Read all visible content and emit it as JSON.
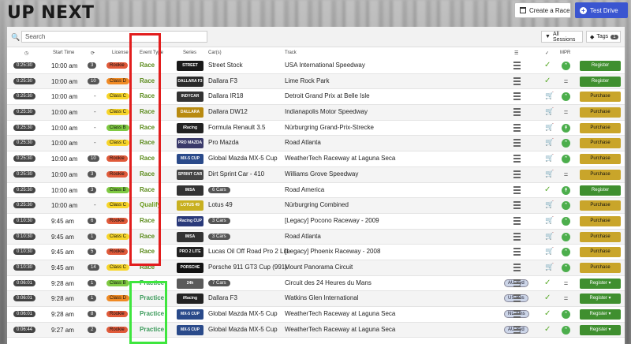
{
  "page": {
    "title": "UP NEXT"
  },
  "buttons": {
    "create_race": "Create a Race",
    "test_drive": "Test Drive",
    "all_sessions": "All Sessions",
    "tags": "Tags",
    "tags_count": "1"
  },
  "search": {
    "placeholder": "Search"
  },
  "headers": {
    "start_time": "Start Time",
    "license": "License",
    "event_type": "Event Type",
    "series": "Series",
    "cars": "Car(s)",
    "track": "Track",
    "mpr": "MPR"
  },
  "colors": {
    "class_d": "#f08a24",
    "class_c": "#f7d52a",
    "class_b": "#7fc942",
    "rookie": "#e05a3a",
    "register": "#3f8f2f",
    "purchase": "#c9a52a",
    "race_box": "#e21d1d",
    "practice_box": "#3ee63e"
  },
  "rows": [
    {
      "timer": "0:25:30",
      "start": "10:00 am",
      "drivers": "3",
      "license": "Rookie",
      "lic_color": "#e05a3a",
      "event": "Race",
      "series_logo": "STREET STOCK",
      "logo_color": "#1a1a1a",
      "cars": "Street Stock",
      "track": "USA International Speedway",
      "owned": true,
      "mpr": "up",
      "action": "Register"
    },
    {
      "timer": "0:25:30",
      "start": "10:00 am",
      "drivers": "10",
      "license": "Class D",
      "lic_color": "#f08a24",
      "event": "Race",
      "series_logo": "DALLARA F3",
      "logo_color": "#2a2a2a",
      "cars": "Dallara F3",
      "track": "Lime Rock Park",
      "owned": true,
      "mpr": "eq",
      "action": "Register"
    },
    {
      "timer": "0:25:30",
      "start": "10:00 am",
      "drivers": "",
      "license": "Class C",
      "lic_color": "#f7d52a",
      "event": "Race",
      "series_logo": "INDYCAR",
      "logo_color": "#333",
      "cars": "Dallara IR18",
      "track": "Detroit Grand Prix at Belle Isle",
      "owned": false,
      "mpr": "up",
      "action": "Purchase"
    },
    {
      "timer": "0:25:30",
      "start": "10:00 am",
      "drivers": "",
      "license": "Class C",
      "lic_color": "#f7d52a",
      "event": "Race",
      "series_logo": "DALLARA DASH",
      "logo_color": "#b88a10",
      "cars": "Dallara DW12",
      "track": "Indianapolis Motor Speedway",
      "owned": false,
      "mpr": "eq",
      "action": "Purchase"
    },
    {
      "timer": "0:25:30",
      "start": "10:00 am",
      "drivers": "",
      "license": "Class B",
      "lic_color": "#7fc942",
      "event": "Race",
      "series_logo": "iRacing FORMULA 3.5",
      "logo_color": "#222",
      "cars": "Formula Renault 3.5",
      "track": "Nürburgring Grand-Prix-Strecke",
      "owned": false,
      "mpr": "up2",
      "action": "Purchase"
    },
    {
      "timer": "0:25:30",
      "start": "10:00 am",
      "drivers": "",
      "license": "Class C",
      "lic_color": "#f7d52a",
      "event": "Race",
      "series_logo": "PRO MAZDA",
      "logo_color": "#3a3a6a",
      "cars": "Pro Mazda",
      "track": "Road Atlanta",
      "owned": false,
      "mpr": "up",
      "action": "Purchase"
    },
    {
      "timer": "0:25:30",
      "start": "10:00 am",
      "drivers": "10",
      "license": "Rookie",
      "lic_color": "#e05a3a",
      "event": "Race",
      "series_logo": "MX-5 CUP",
      "logo_color": "#2a4a8a",
      "cars": "Global Mazda MX-5 Cup",
      "track": "WeatherTech Raceway at Laguna Seca",
      "owned": false,
      "mpr": "up",
      "action": "Purchase"
    },
    {
      "timer": "0:25:30",
      "start": "10:00 am",
      "drivers": "3",
      "license": "Rookie",
      "lic_color": "#e05a3a",
      "event": "Race",
      "series_logo": "SPRINT CAR",
      "logo_color": "#444",
      "cars": "Dirt Sprint Car - 410",
      "track": "Williams Grove Speedway",
      "owned": false,
      "mpr": "eq",
      "action": "Purchase"
    },
    {
      "timer": "0:25:30",
      "start": "10:00 am",
      "drivers": "3",
      "license": "Class B",
      "lic_color": "#7fc942",
      "event": "Race",
      "series_logo": "IMSA",
      "logo_color": "#333",
      "cars": "6 Cars",
      "cars_badge": true,
      "track": "Road America",
      "owned": true,
      "mpr": "up2",
      "action": "Register"
    },
    {
      "timer": "0:25:30",
      "start": "10:00 am",
      "drivers": "",
      "license": "Class C",
      "lic_color": "#f7d52a",
      "event": "Qualify",
      "series_logo": "LOTUS 49",
      "logo_color": "#c8b020",
      "cars": "Lotus 49",
      "track": "Nürburgring Combined",
      "owned": false,
      "mpr": "up",
      "action": "Purchase"
    },
    {
      "timer": "0:10:30",
      "start": "9:45 am",
      "drivers": "6",
      "license": "Rookie",
      "lic_color": "#e05a3a",
      "event": "Race",
      "series_logo": "iRacing CUP",
      "logo_color": "#2a3a7a",
      "cars": "3 Cars",
      "cars_badge": true,
      "track": "[Legacy] Pocono Raceway - 2009",
      "owned": false,
      "mpr": "up",
      "action": "Purchase"
    },
    {
      "timer": "0:10:30",
      "start": "9:45 am",
      "drivers": "1",
      "license": "Class C",
      "lic_color": "#f7d52a",
      "event": "Race",
      "series_logo": "IMSA",
      "logo_color": "#333",
      "cars": "3 Cars",
      "cars_badge": true,
      "track": "Road Atlanta",
      "owned": false,
      "mpr": "up",
      "action": "Purchase"
    },
    {
      "timer": "0:10:30",
      "start": "9:45 am",
      "drivers": "5",
      "license": "Rookie",
      "lic_color": "#e05a3a",
      "event": "Race",
      "series_logo": "PRO 2 LITE",
      "logo_color": "#222",
      "cars": "Lucas Oil Off Road Pro 2 Lite",
      "track": "[Legacy] Phoenix Raceway - 2008",
      "owned": false,
      "mpr": "up",
      "action": "Purchase"
    },
    {
      "timer": "0:10:30",
      "start": "9:45 am",
      "drivers": "14",
      "license": "Class C",
      "lic_color": "#f7d52a",
      "event": "Race",
      "series_logo": "PORSCHE",
      "logo_color": "#111",
      "cars": "Porsche 911 GT3 Cup (991)",
      "track": "Mount Panorama Circuit",
      "owned": false,
      "mpr": "up",
      "action": "Purchase"
    },
    {
      "timer": "0:06:01",
      "start": "9:28 am",
      "drivers": "1",
      "license": "Class B",
      "lic_color": "#7fc942",
      "event": "Practice",
      "series_logo": "24h",
      "logo_color": "#5a5a5a",
      "cars": "7 Cars",
      "cars_badge": true,
      "track": "Circuit des 24 Heures du Mans",
      "server": "AU-Syd",
      "owned": true,
      "mpr": "eq",
      "action": "Register ▾"
    },
    {
      "timer": "0:06:01",
      "start": "9:28 am",
      "drivers": "1",
      "license": "Class D",
      "lic_color": "#f08a24",
      "event": "Practice",
      "series_logo": "iRacing FORMULA 3",
      "logo_color": "#222",
      "cars": "Dallara F3",
      "track": "Watkins Glen International",
      "server": "US-Bos",
      "owned": true,
      "mpr": "eq",
      "action": "Register ▾"
    },
    {
      "timer": "0:06:01",
      "start": "9:28 am",
      "drivers": "8",
      "license": "Rookie",
      "lic_color": "#e05a3a",
      "event": "Practice",
      "series_logo": "MX-5 CUP",
      "logo_color": "#2a4a8a",
      "cars": "Global Mazda MX-5 Cup",
      "track": "WeatherTech Raceway at Laguna Seca",
      "server": "NL-Ams",
      "owned": true,
      "mpr": "up",
      "action": "Register ▾"
    },
    {
      "timer": "0:06:44",
      "start": "9:27 am",
      "drivers": "2",
      "license": "Rookie",
      "lic_color": "#e05a3a",
      "event": "Practice",
      "series_logo": "MX-5 CUP",
      "logo_color": "#2a4a8a",
      "cars": "Global Mazda MX-5 Cup",
      "track": "WeatherTech Raceway at Laguna Seca",
      "server": "AU-Syd",
      "owned": true,
      "mpr": "up",
      "action": "Register ▾"
    }
  ]
}
